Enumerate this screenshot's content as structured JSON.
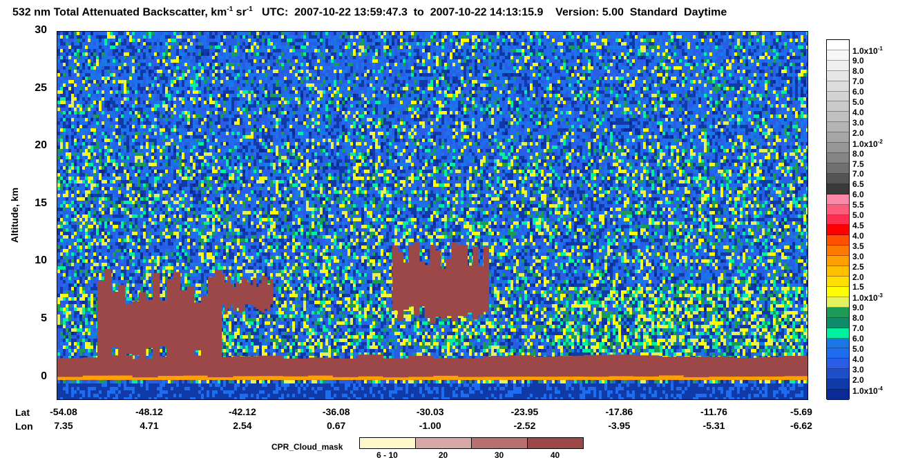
{
  "title": {
    "prefix": "532 nm Total Attenuated Backscatter, km",
    "exp1": "-1",
    "mid": " sr",
    "exp2": "-1",
    "utc": "   UTC:  2007-10-22 13:59:47.3  to  2007-10-22 14:13:15.9    Version: 5.00  Standard  Daytime"
  },
  "axes": {
    "ylabel": "Altitude, km",
    "yticks": [
      "30",
      "25",
      "20",
      "15",
      "10",
      "5",
      "0"
    ],
    "lat_label": "Lat",
    "lon_label": "Lon",
    "lat_ticks": [
      "-54.08",
      "-48.12",
      "-42.12",
      "-36.08",
      "-30.03",
      "-23.95",
      "-17.86",
      "-11.76",
      "-5.69"
    ],
    "lon_ticks": [
      "7.35",
      "4.71",
      "2.54",
      "0.67",
      "-1.00",
      "-2.52",
      "-3.95",
      "-5.31",
      "-6.62"
    ]
  },
  "colorbar": {
    "labels": [
      {
        "m": "1.0x10",
        "e": "-1"
      },
      {
        "m": "9.0"
      },
      {
        "m": "8.0"
      },
      {
        "m": "7.0"
      },
      {
        "m": "6.0"
      },
      {
        "m": "5.0"
      },
      {
        "m": "4.0"
      },
      {
        "m": "3.0"
      },
      {
        "m": "2.0"
      },
      {
        "m": "1.0x10",
        "e": "-2"
      },
      {
        "m": "8.0"
      },
      {
        "m": "7.5"
      },
      {
        "m": "7.0"
      },
      {
        "m": "6.5"
      },
      {
        "m": "6.0"
      },
      {
        "m": "5.5"
      },
      {
        "m": "5.0"
      },
      {
        "m": "4.5"
      },
      {
        "m": "4.0"
      },
      {
        "m": "3.5"
      },
      {
        "m": "3.0"
      },
      {
        "m": "2.5"
      },
      {
        "m": "2.0"
      },
      {
        "m": "1.5"
      },
      {
        "m": "1.0x10",
        "e": "-3"
      },
      {
        "m": "9.0"
      },
      {
        "m": "8.0"
      },
      {
        "m": "7.0"
      },
      {
        "m": "6.0"
      },
      {
        "m": "5.0"
      },
      {
        "m": "4.0"
      },
      {
        "m": "3.0"
      },
      {
        "m": "2.0"
      },
      {
        "m": "1.0x10",
        "e": "-4"
      }
    ],
    "colors": [
      "#ffffff",
      "#f7f7f7",
      "#efefef",
      "#e6e6e6",
      "#dddddd",
      "#d3d3d3",
      "#cacaca",
      "#c0c0c0",
      "#b4b4b4",
      "#a6a6a6",
      "#969696",
      "#858585",
      "#707070",
      "#545454",
      "#3a3a3a",
      "#ff88a8",
      "#ff5c7c",
      "#ff2f50",
      "#ff0000",
      "#ff5000",
      "#ff7a00",
      "#ff9f00",
      "#ffc000",
      "#ffdf00",
      "#ffff00",
      "#e3f060",
      "#1c9b57",
      "#108a6c",
      "#00f0a0",
      "#1a78e6",
      "#1e6cf0",
      "#2a5ce6",
      "#1e4fc8",
      "#0f3aa8",
      "#0a2a96"
    ]
  },
  "cpr_legend": {
    "title": "CPR_Cloud_mask",
    "labels": [
      "6 - 10",
      "20",
      "30",
      "40"
    ],
    "colors": [
      "#fff8c8",
      "#d8a8a8",
      "#b87070",
      "#9c4848"
    ]
  },
  "chart_data": {
    "type": "heatmap",
    "title": "532 nm Total Attenuated Backscatter, km-1 sr-1",
    "ylabel": "Altitude, km",
    "xlabel": "",
    "ylim": [
      -2,
      30
    ],
    "yticks": [
      0,
      5,
      10,
      15,
      20,
      25,
      30
    ],
    "x": {
      "lat": [
        -54.08,
        -48.12,
        -42.12,
        -36.08,
        -30.03,
        -23.95,
        -17.86,
        -11.76,
        -5.69
      ],
      "lon": [
        7.35,
        4.71,
        2.54,
        0.67,
        -1.0,
        -2.52,
        -3.95,
        -5.31,
        -6.62
      ]
    },
    "time_range": [
      "2007-10-22 13:59:47.3",
      "2007-10-22 14:13:15.9"
    ],
    "version": "5.00",
    "colorbar_range": [
      0.0001,
      0.1
    ],
    "cloud_mask_categories": [
      "6 - 10",
      "20",
      "30",
      "40"
    ],
    "cloud_mask_features": [
      {
        "lat": [
          -51.5,
          -43.5
        ],
        "altitude_km": [
          0.5,
          9.5
        ],
        "category": "40"
      },
      {
        "lat": [
          -43.5,
          -40.2
        ],
        "altitude_km": [
          5.5,
          9.0
        ],
        "category": "40"
      },
      {
        "lat": [
          -32.5,
          -26.3
        ],
        "altitude_km": [
          4.5,
          12.0
        ],
        "category": "40"
      },
      {
        "lat": [
          -54.08,
          -5.69
        ],
        "altitude_km": [
          0,
          2
        ],
        "category": "40"
      }
    ]
  }
}
